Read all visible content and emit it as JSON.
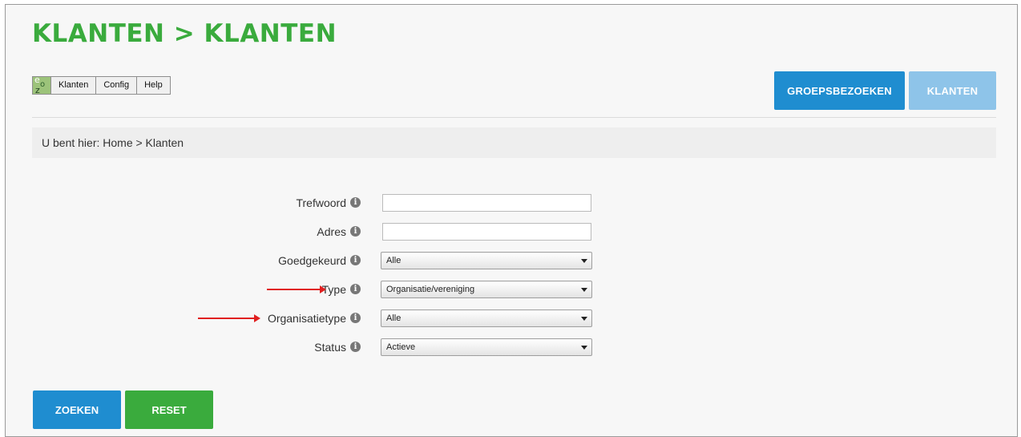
{
  "title": "KLANTEN > KLANTEN",
  "menubar": {
    "items": [
      "Klanten",
      "Config",
      "Help"
    ]
  },
  "top_buttons": {
    "groepsbezoeken": "GROEPSBEZOEKEN",
    "klanten": "KLANTEN"
  },
  "breadcrumb": "U bent hier: Home > Klanten",
  "form": {
    "trefwoord": {
      "label": "Trefwoord",
      "value": ""
    },
    "adres": {
      "label": "Adres",
      "value": ""
    },
    "goedgekeurd": {
      "label": "Goedgekeurd",
      "selected": "Alle"
    },
    "type": {
      "label": "Type",
      "selected": "Organisatie/vereniging"
    },
    "organisatietype": {
      "label": "Organisatietype",
      "selected": "Alle"
    },
    "status": {
      "label": "Status",
      "selected": "Actieve"
    }
  },
  "actions": {
    "zoeken": "ZOEKEN",
    "reset": "RESET"
  },
  "icons": {
    "info": "info-icon",
    "select_arrow": "chevron-down-icon"
  },
  "colors": {
    "title_green": "#3aab3d",
    "primary_blue": "#1f8dd0",
    "inactive_blue": "#8ec4e9",
    "reset_green": "#3aab3d",
    "annotation_red": "#e02020"
  }
}
